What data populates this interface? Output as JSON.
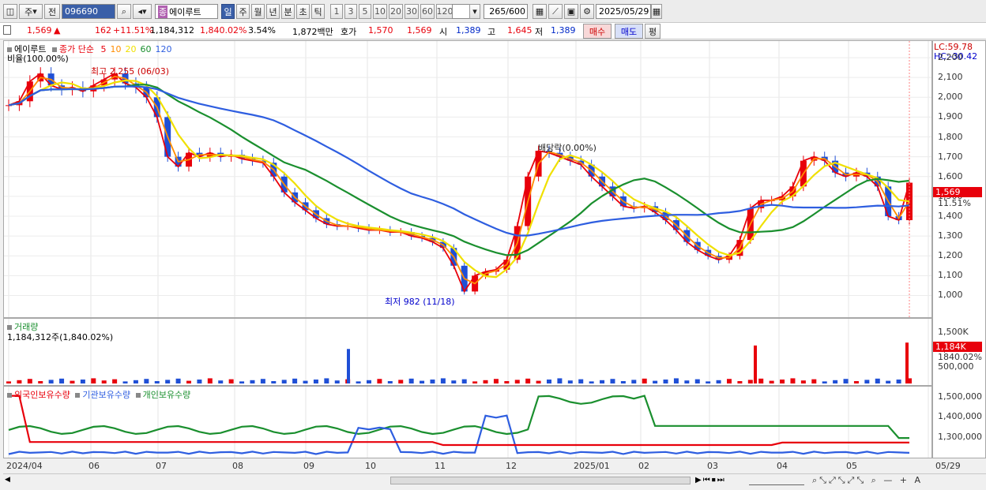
{
  "toolbar": {
    "mode_label": "주",
    "jeon_label": "전",
    "code_value": "096690",
    "stock_name": "에이루트",
    "stock_prefix": "종",
    "periods": [
      "일",
      "주",
      "월",
      "년",
      "분",
      "초",
      "틱"
    ],
    "active_period": "일",
    "intervals": [
      "1",
      "3",
      "5",
      "10",
      "20",
      "30",
      "60",
      "120"
    ],
    "count_value": "265",
    "count_total": "/600",
    "date_value": "2025/05/29"
  },
  "quote": {
    "price": "1,569",
    "change_arrow": "▲",
    "change": "162",
    "change_pct": "+11.51%",
    "volume": "1,184,312",
    "volume_pct": "1,840.02%",
    "turnover": "3.54%",
    "amount": "1,872백만",
    "bid_label": "호가",
    "ask_price": "1,570",
    "bid_price": "1,569",
    "open_label": "시",
    "open": "1,389",
    "high_label": "고",
    "high": "1,645",
    "low_label": "저",
    "low": "1,389",
    "buy_label": "매수",
    "sell_label": "매도",
    "eval_label": "평"
  },
  "price_pane": {
    "legend_name": "에이루트",
    "legend_sub": "비율(100.00%)",
    "ma_label": "종가 단순",
    "ma_periods": [
      "5",
      "10",
      "20",
      "60",
      "120"
    ],
    "ma_colors": [
      "#e8000b",
      "#ff8c00",
      "#f0e000",
      "#1a8f2e",
      "#2e5ee0"
    ],
    "lc_label": "LC:59.78",
    "hc_label": "HC:-30.42",
    "high_note": "최고 2,255 (06/03)",
    "low_note": "최저 982 (11/18)",
    "div_note": "배당락(0.00%)",
    "price_tag": "1,569",
    "price_pct": "11.51%",
    "y_ticks": [
      "2,200",
      "2,100",
      "2,000",
      "1,900",
      "1,800",
      "1,700",
      "1,600",
      "1,500",
      "1,400",
      "1,300",
      "1,200",
      "1,100",
      "1,000"
    ]
  },
  "volume_pane": {
    "title": "거래량",
    "value": "1,184,312주(1,840.02%)",
    "y_ticks": [
      "1,500K",
      "1,000K",
      "500,000"
    ],
    "tag": "1,184K",
    "tag_pct": "1840.02%"
  },
  "holding_pane": {
    "series": [
      "외국인보유수량",
      "기관보유수량",
      "개인보유수량"
    ],
    "y_ticks": [
      "1,500,000",
      "1,400,000",
      "1,300,000"
    ]
  },
  "x_axis": {
    "ticks": [
      "2024/04",
      "06",
      "07",
      "08",
      "09",
      "10",
      "11",
      "12",
      "2025/01",
      "02",
      "03",
      "04",
      "05",
      "05/29"
    ]
  },
  "chart_data": {
    "type": "line",
    "title": "에이루트",
    "y_range": [
      950,
      2260
    ],
    "close_series": [
      {
        "name": "종가",
        "values": [
          1960,
          1980,
          2080,
          2120,
          2060,
          2040,
          2050,
          2030,
          2060,
          2090,
          2120,
          2070,
          2050,
          2000,
          1900,
          1700,
          1650,
          1720,
          1700,
          1720,
          1700,
          1710,
          1690,
          1680,
          1670,
          1600,
          1520,
          1470,
          1430,
          1390,
          1360,
          1350,
          1350,
          1340,
          1330,
          1330,
          1320,
          1320,
          1300,
          1290,
          1270,
          1240,
          1150,
          1020,
          1100,
          1120,
          1130,
          1180,
          1350,
          1600,
          1730,
          1720,
          1700,
          1680,
          1660,
          1600,
          1550,
          1500,
          1450,
          1440,
          1450,
          1420,
          1380,
          1330,
          1270,
          1230,
          1200,
          1180,
          1200,
          1280,
          1440,
          1480,
          1480,
          1500,
          1550,
          1680,
          1700,
          1680,
          1620,
          1600,
          1620,
          1600,
          1550,
          1400,
          1380,
          1569
        ]
      }
    ],
    "volume_spikes": [
      {
        "x": "09",
        "value": 1000000
      },
      {
        "x": "03",
        "value": 1100000
      },
      {
        "x": "05/29",
        "value": 1184312
      }
    ]
  }
}
